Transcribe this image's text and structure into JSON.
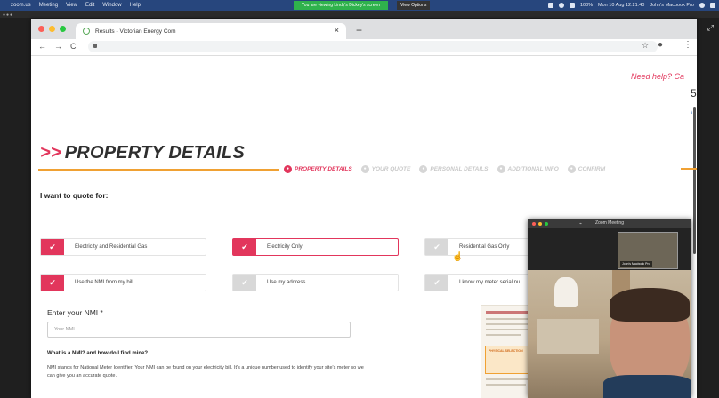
{
  "menubar": {
    "app": "zoom.us",
    "items": [
      "Meeting",
      "View",
      "Edit",
      "Window",
      "Help"
    ],
    "share_banner": "You are viewing Lindy's Dickey's screen",
    "view_options": "View Options",
    "battery": "100%",
    "datetime": "Mon 10 Aug 12:21:40",
    "user": "John's Macbook Pro"
  },
  "browser": {
    "tab_title": "Results - Victorian Energy Com",
    "tab_close": "×",
    "new_tab": "+",
    "back": "←",
    "forward": "→",
    "reload": "C",
    "bookmark": "☆",
    "account": "●",
    "menu": "⋮"
  },
  "page": {
    "need_help": "Need help? Ca",
    "edge_text": "5",
    "edge_blue": "\\",
    "title_arrows": ">>",
    "title": "PROPERTY DETAILS",
    "steps": [
      {
        "label": "PROPERTY DETAILS",
        "active": true
      },
      {
        "label": "YOUR QUOTE",
        "active": false
      },
      {
        "label": "PERSONAL DETAILS",
        "active": false
      },
      {
        "label": "ADDITIONAL INFO",
        "active": false
      },
      {
        "label": "CONFIRM",
        "active": false
      }
    ],
    "quote_heading": "I want to quote for:",
    "options": {
      "elec_gas": {
        "label": "Electricity and Residential Gas",
        "selected": true
      },
      "elec_only": {
        "label": "Electricity Only",
        "selected": true
      },
      "gas_only": {
        "label": "Residential Gas Only",
        "selected": false
      },
      "nmi_bill": {
        "label": "Use the NMI from my bill",
        "selected": true
      },
      "my_address": {
        "label": "Use my address",
        "selected": false
      },
      "meter_serial": {
        "label": "I know my meter serial nu",
        "selected": false
      }
    },
    "check": "✔",
    "nmi_label": "Enter your NMI *",
    "nmi_placeholder": "Your NMI",
    "nmi_question": "What is a NMI? and how do I find mine?",
    "nmi_paragraph": "NMI stands for National Meter Identifier. Your NMI can be found on your electricity bill. It's a unique number used to identify your site's meter so we can give you an accurate quote.",
    "bill_card_label": "PHYSICAL SELECTION"
  },
  "zoom": {
    "title": "Zoom Meeting",
    "thumb_name": "John's Macbook Pro"
  },
  "colors": {
    "accent": "#e2365c",
    "underline": "#f0a133",
    "menubar": "#27467d",
    "share_green": "#2fb24c"
  }
}
